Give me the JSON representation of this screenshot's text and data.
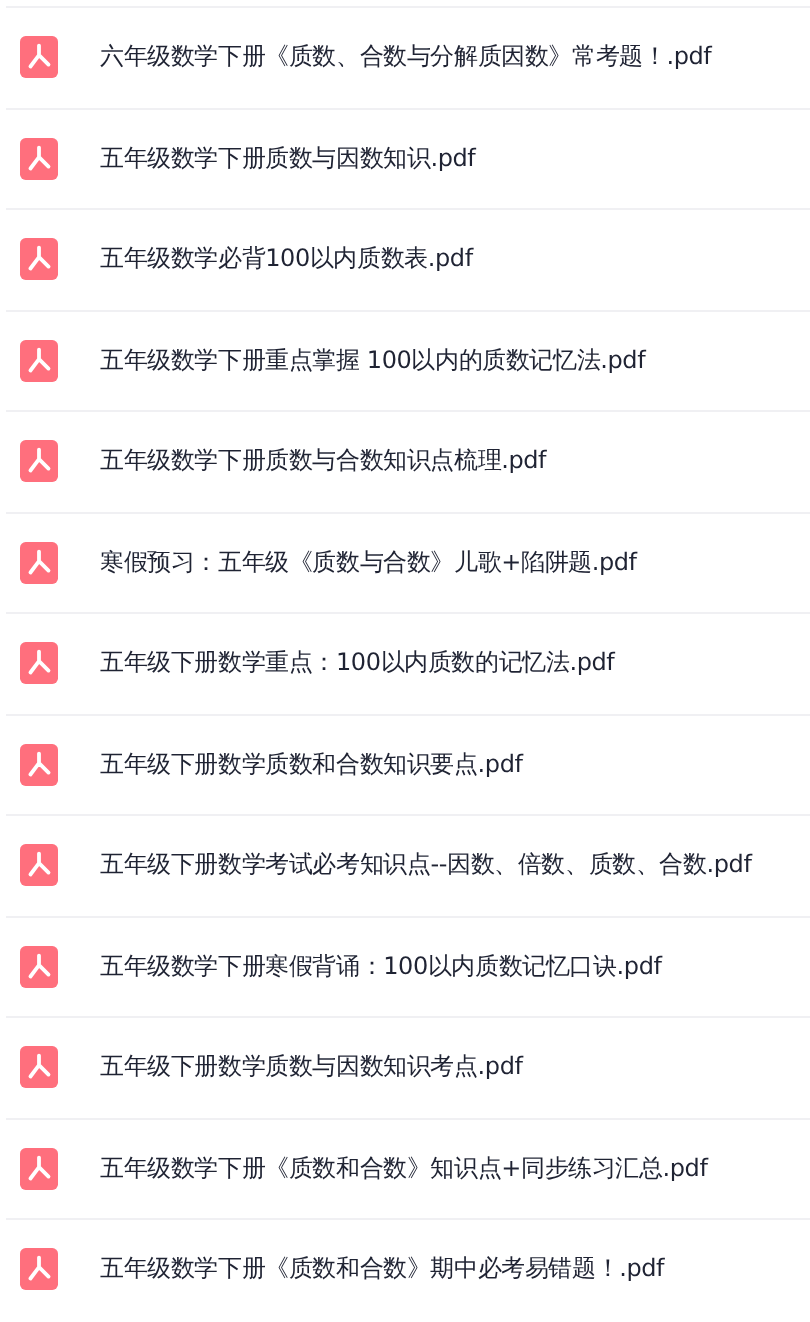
{
  "files": [
    {
      "name": "六年级数学下册《质数、合数与分解质因数》常考题！.pdf"
    },
    {
      "name": "五年级数学下册质数与因数知识.pdf"
    },
    {
      "name": "五年级数学必背100以内质数表.pdf"
    },
    {
      "name": "五年级数学下册重点掌握 100以内的质数记忆法.pdf"
    },
    {
      "name": "五年级数学下册质数与合数知识点梳理.pdf"
    },
    {
      "name": "寒假预习：五年级《质数与合数》儿歌+陷阱题.pdf"
    },
    {
      "name": "五年级下册数学重点：100以内质数的记忆法.pdf"
    },
    {
      "name": "五年级下册数学质数和合数知识要点.pdf"
    },
    {
      "name": "五年级下册数学考试必考知识点--因数、倍数、质数、合数.pdf"
    },
    {
      "name": "五年级数学下册寒假背诵：100以内质数记忆口诀.pdf"
    },
    {
      "name": "五年级下册数学质数与因数知识考点.pdf"
    },
    {
      "name": "五年级数学下册《质数和合数》知识点+同步练习汇总.pdf"
    },
    {
      "name": "五年级数学下册《质数和合数》期中必考易错题！.pdf"
    }
  ]
}
